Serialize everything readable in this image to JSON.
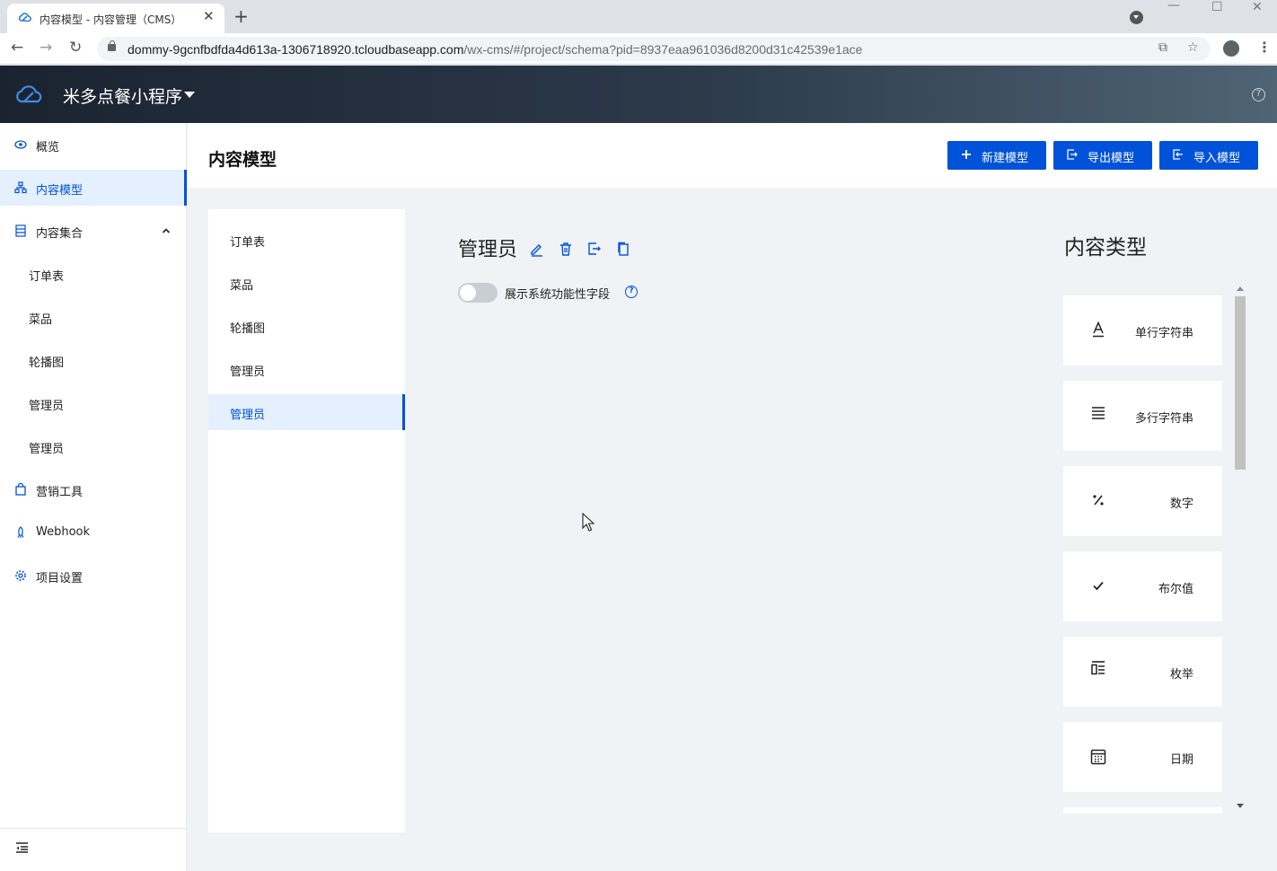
{
  "browser": {
    "tab_title": "内容模型 - 内容管理（CMS）",
    "tab_close": "✕",
    "new_tab": "+",
    "url_host": "dommy-9gcnfbdfda4d613a-1306718920.tcloudbaseapp.com",
    "url_path": "/wx-cms/#/project/schema?pid=8937eaa961036d8200d31c42539e1ace",
    "window_controls": [
      "—",
      "☐",
      "✕"
    ]
  },
  "app": {
    "project_name": "米多点餐小程序",
    "help_label": "?"
  },
  "sidebar": {
    "items": [
      {
        "label": "概览",
        "icon": "eye-icon"
      },
      {
        "label": "内容模型",
        "icon": "model-icon",
        "active": true
      },
      {
        "label": "内容集合",
        "icon": "collection-icon",
        "expanded": true
      },
      {
        "label": "订单表"
      },
      {
        "label": "菜品"
      },
      {
        "label": "轮播图"
      },
      {
        "label": "管理员"
      },
      {
        "label": "管理员"
      },
      {
        "label": "营销工具",
        "icon": "bag-icon"
      },
      {
        "label": "Webhook",
        "icon": "rocket-icon"
      },
      {
        "label": "项目设置",
        "icon": "gear-icon"
      }
    ]
  },
  "page": {
    "title": "内容模型",
    "buttons": {
      "new_model": "新建模型",
      "export_model": "导出模型",
      "import_model": "导入模型"
    }
  },
  "models": {
    "items": [
      "订单表",
      "菜品",
      "轮播图",
      "管理员",
      "管理员"
    ],
    "active_index": 4
  },
  "detail": {
    "title": "管理员",
    "toggle_label": "展示系统功能性字段",
    "toggle_on": false
  },
  "content_types": {
    "title": "内容类型",
    "items": [
      {
        "label": "单行字符串",
        "icon": "single-line-text-icon"
      },
      {
        "label": "多行字符串",
        "icon": "multi-line-text-icon"
      },
      {
        "label": "数字",
        "icon": "percent-icon"
      },
      {
        "label": "布尔值",
        "icon": "check-icon"
      },
      {
        "label": "枚举",
        "icon": "enum-icon"
      },
      {
        "label": "日期",
        "icon": "calendar-icon"
      }
    ]
  },
  "colors": {
    "primary": "#0052d9",
    "active_bg": "#e5f0ff"
  }
}
